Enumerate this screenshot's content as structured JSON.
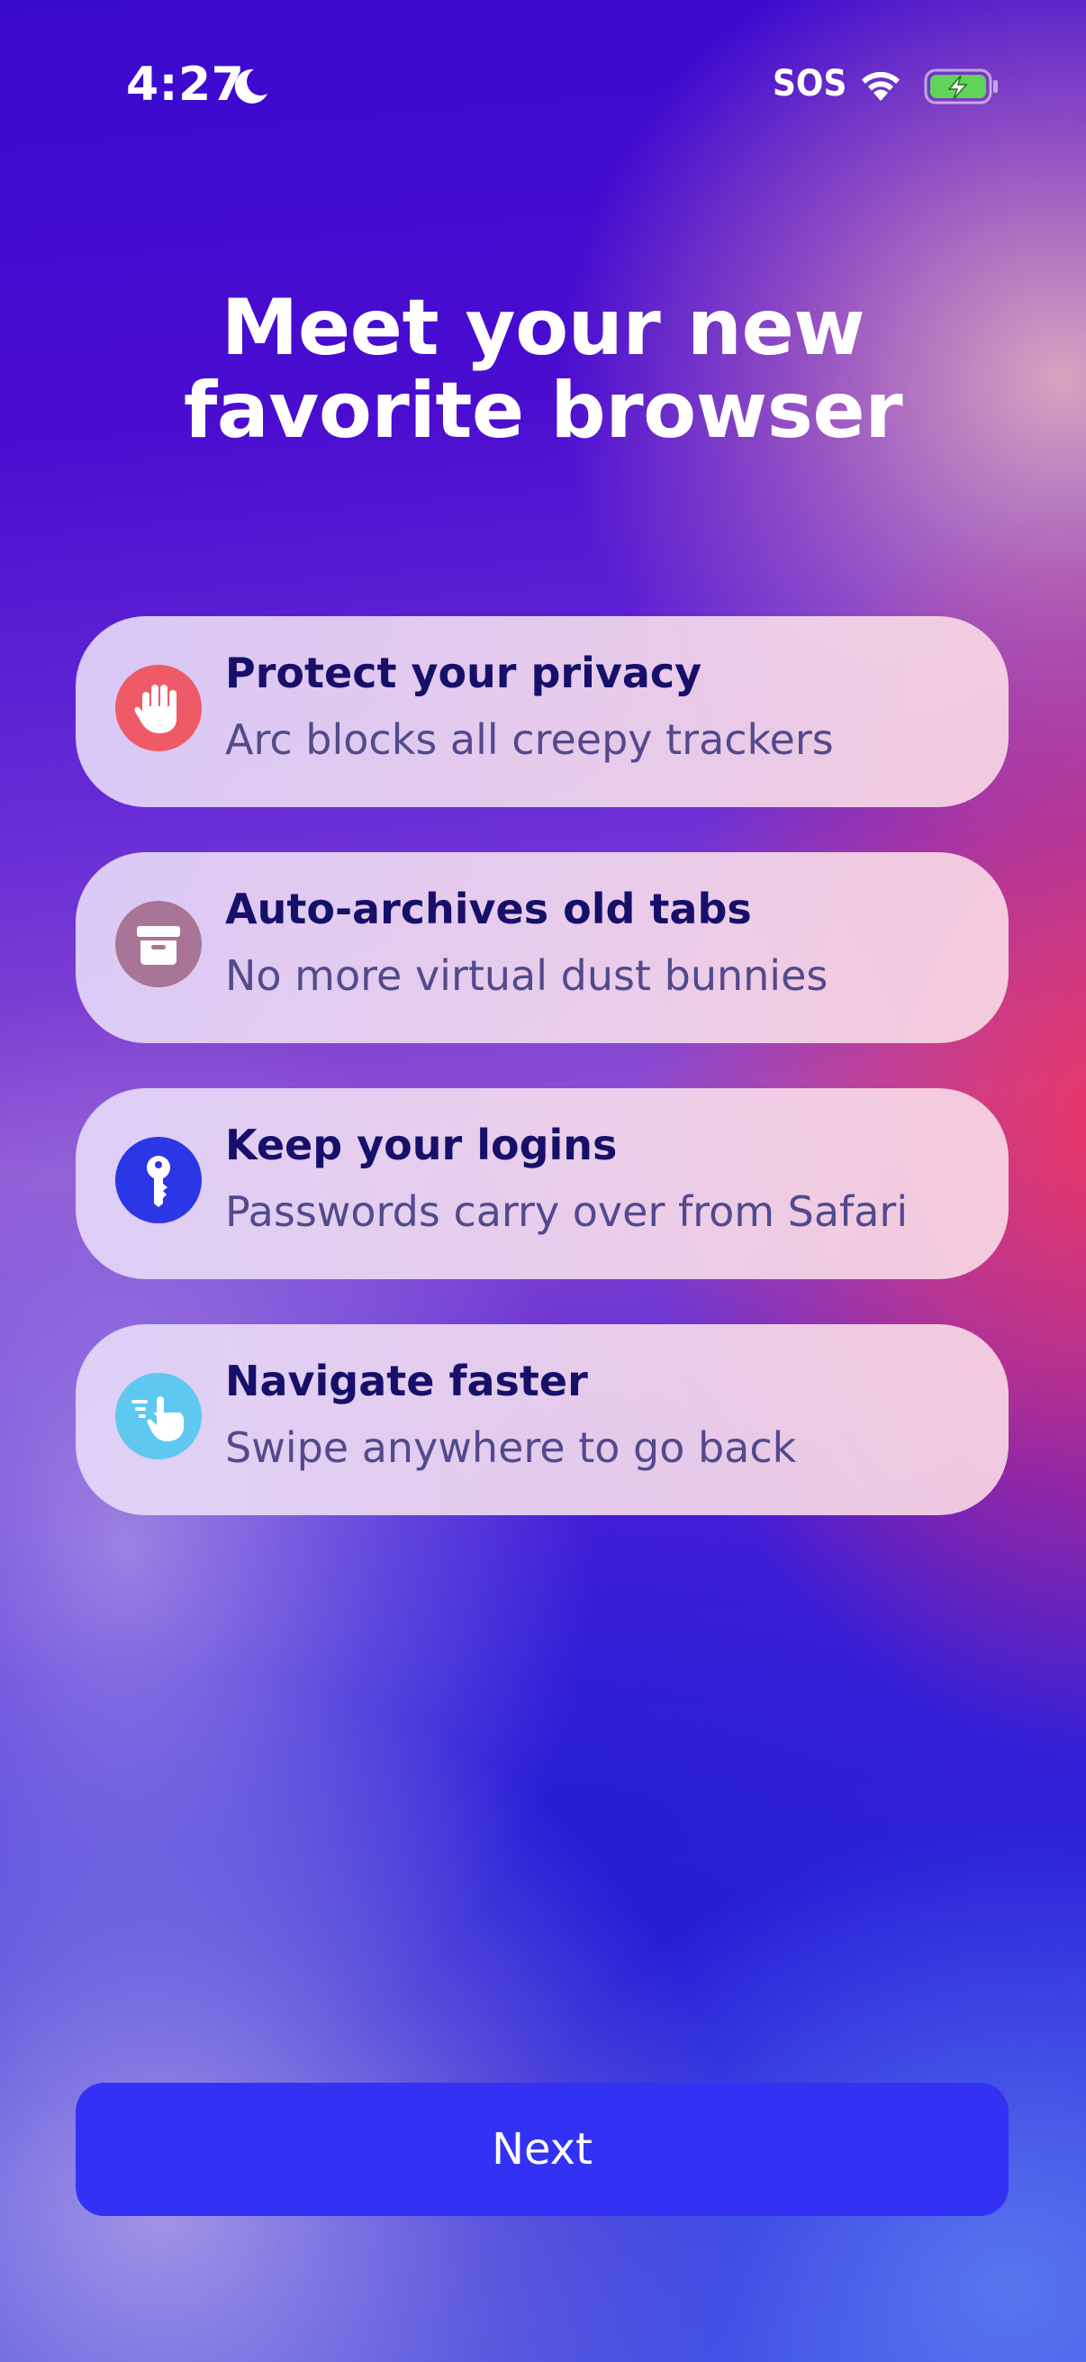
{
  "status_bar": {
    "time": "4:27",
    "sos": "SOS",
    "icons": [
      "moon-icon",
      "wifi-icon",
      "battery-charging-icon"
    ]
  },
  "header": {
    "title_line1": "Meet your new",
    "title_line2": "favorite browser"
  },
  "features": [
    {
      "title": "Protect your privacy",
      "subtitle": "Arc blocks all creepy trackers",
      "icon": "hand-stop-icon",
      "icon_color": "#ee5b66"
    },
    {
      "title": "Auto-archives old tabs",
      "subtitle": "No more virtual dust bunnies",
      "icon": "archive-box-icon",
      "icon_color": "#a87596"
    },
    {
      "title": "Keep your logins",
      "subtitle": "Passwords carry over from Safari",
      "icon": "key-icon",
      "icon_color": "#2b36e6"
    },
    {
      "title": "Navigate faster",
      "subtitle": "Swipe anywhere to go back",
      "icon": "swipe-hand-icon",
      "icon_color": "#5ec8f1"
    }
  ],
  "footer": {
    "next_label": "Next"
  },
  "colors": {
    "button": "#3332f4",
    "card_title": "#17106a",
    "card_subtitle": "#524a8c",
    "battery_fill": "#5fd35a"
  }
}
